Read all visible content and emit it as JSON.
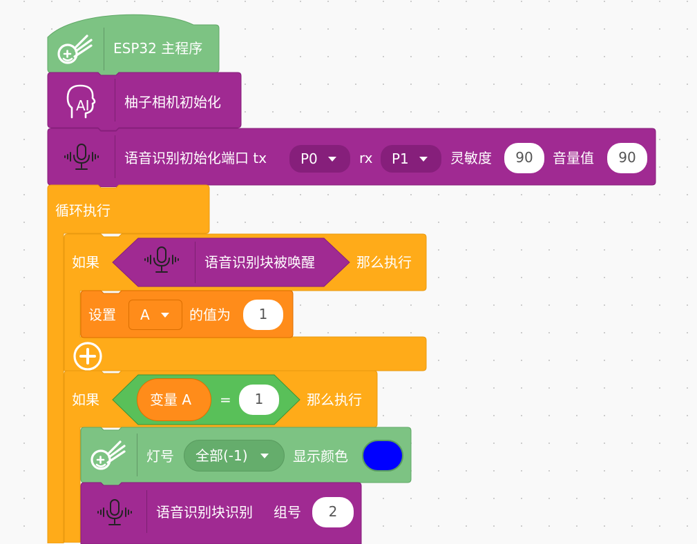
{
  "main_program": {
    "label": "ESP32 主程序"
  },
  "camera_init": {
    "label": "柚子相机初始化"
  },
  "voice_init": {
    "label": "语音识别初始化端口 tx",
    "tx_value": "P0",
    "rx_label": "rx",
    "rx_value": "P1",
    "sensitivity_label": "灵敏度",
    "sensitivity_value": "90",
    "volume_label": "音量值",
    "volume_value": "90"
  },
  "loop": {
    "label": "循环执行"
  },
  "if1": {
    "if_label": "如果",
    "condition_label": "语音识别块被唤醒",
    "then_label": "那么执行"
  },
  "set_var": {
    "label": "设置",
    "var_value": "A",
    "value_label": "的值为",
    "value": "1"
  },
  "if2": {
    "if_label": "如果",
    "var_label": "变量 A",
    "operator": "=",
    "value": "1",
    "then_label": "那么执行"
  },
  "led_block": {
    "label": "灯号",
    "led_value": "全部(-1)",
    "color_label": "显示颜色",
    "color": "#0000ff"
  },
  "recognize": {
    "label": "语音识别块识别",
    "group_label": "组号",
    "group_value": "2"
  },
  "colors": {
    "green": "#7dc383",
    "purple": "#a02a92",
    "orange": "#ffab19",
    "dark_orange": "#ff8c1a",
    "compare_green": "#59c059"
  }
}
